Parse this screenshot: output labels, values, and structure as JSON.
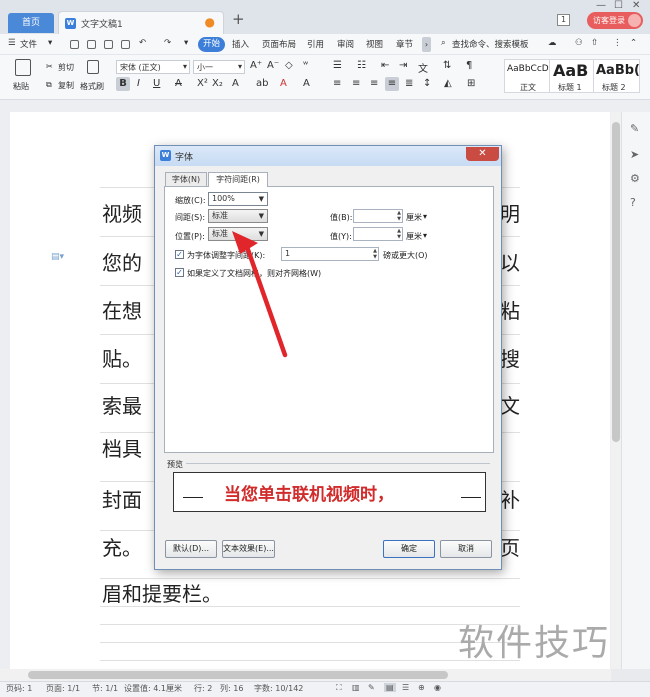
{
  "titlebar": {
    "home_tab": "首页",
    "doc_tab": "文字文稿1",
    "doc_badge": "W",
    "unsaved_dot": "●",
    "new_tab": "+",
    "page_count": "1",
    "guest_login": "访客登录"
  },
  "menu": {
    "file": "文件",
    "items": [
      "开始",
      "插入",
      "页面布局",
      "引用",
      "审阅",
      "视图",
      "章节"
    ],
    "search": "查找命令、搜索模板"
  },
  "ribbon": {
    "paste": "粘贴",
    "cut": "剪切",
    "copy": "复制",
    "format_painter": "格式刷",
    "font_name": "宋体 (正文)",
    "font_size": "小一",
    "styles": [
      {
        "preview": "AaBbCcD",
        "name": "正文"
      },
      {
        "preview": "AaB",
        "name": "标题 1"
      },
      {
        "preview": "AaBb(",
        "name": "标题 2"
      }
    ]
  },
  "document": {
    "left_column": [
      "视频",
      "您的",
      "在想",
      "贴。",
      "索最",
      "档具",
      "封面",
      "充。",
      "眉和提要栏。"
    ],
    "right_column": [
      "明",
      "以",
      "粘",
      "搜",
      "文",
      "补",
      "页"
    ]
  },
  "dialog": {
    "title": "字体",
    "close": "✕",
    "tab_font": "字体(N)",
    "tab_spacing": "字符间距(R)",
    "scale_label": "缩放(C):",
    "scale_value": "100%",
    "spacing_label": "间距(S):",
    "spacing_value": "标准",
    "position_label": "位置(P):",
    "position_value": "标准",
    "value_b_label": "值(B):",
    "value_y_label": "值(Y):",
    "unit": "厘米",
    "kerning_label": "为字体调整字间距(K):",
    "kerning_value": "1",
    "kerning_suffix": "磅或更大(O)",
    "grid_label": "如果定义了文档网格，则对齐网格(W)",
    "preview_label": "预览",
    "preview_text": "当您单击联机视频时，",
    "btn_default": "默认(D)...",
    "btn_effects": "文本效果(E)...",
    "btn_ok": "确定",
    "btn_cancel": "取消"
  },
  "statusbar": {
    "page_no": "页码: 1",
    "pages": "页面: 1/1",
    "section": "节: 1/1",
    "setting": "设置值: 4.1厘米",
    "row": "行: 2",
    "col": "列: 16",
    "words": "字数: 10/142"
  },
  "watermark": "软件技巧",
  "colors": {
    "accent": "#3d7fd8",
    "annotation_arrow": "#e0262b",
    "preview_text": "#d12b2b"
  }
}
